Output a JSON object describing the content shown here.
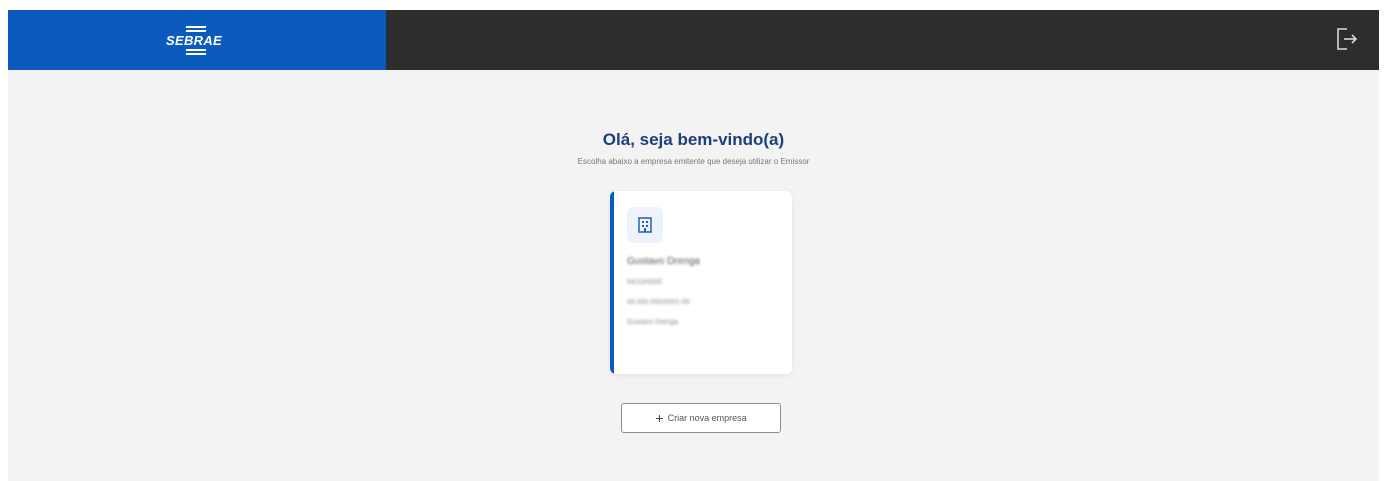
{
  "header": {
    "logo_text": "SEBRAE",
    "logout_icon": "logout-icon"
  },
  "main": {
    "title": "Olá, seja bem-vindo(a)",
    "subtitle": "Escolha abaixo a empresa emitente que deseja utilizar o Emissor"
  },
  "company_card": {
    "icon": "building-icon",
    "name": "Gustavo Drenga",
    "line1": "04/10/0000",
    "line2": "00.000.000/0001-00",
    "line3": "Gustavo Drenga"
  },
  "create_button": {
    "icon": "plus-icon",
    "label": "Criar nova empresa"
  },
  "colors": {
    "brand_blue": "#0a5bbd",
    "topbar_dark": "#2d2d2d",
    "title_blue": "#1d3f7a",
    "background": "#f3f3f3"
  }
}
